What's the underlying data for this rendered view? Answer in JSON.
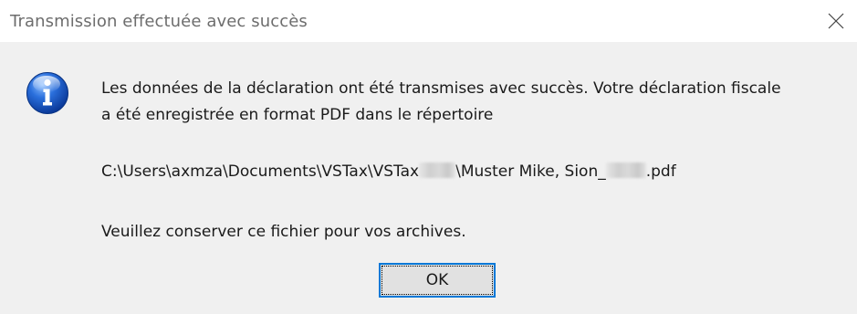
{
  "dialog": {
    "title": "Transmission effectuée avec succès",
    "close_icon": "close-icon",
    "info_icon": "info-icon",
    "message_line1": "Les données de la déclaration ont été transmises avec succès. Votre déclaration fiscale",
    "message_line2": "a été enregistrée en format PDF dans le répertoire",
    "path_part1": "C:\\Users\\axmza\\Documents\\VSTax\\VSTax",
    "path_part2": "\\Muster Mike, Sion_",
    "path_part3": ".pdf",
    "keep_message": "Veuillez conserver ce fichier pour vos archives.",
    "ok_label": "OK"
  },
  "colors": {
    "accent": "#0078d7",
    "background": "#f0f0f0",
    "titlebar": "#ffffff"
  }
}
